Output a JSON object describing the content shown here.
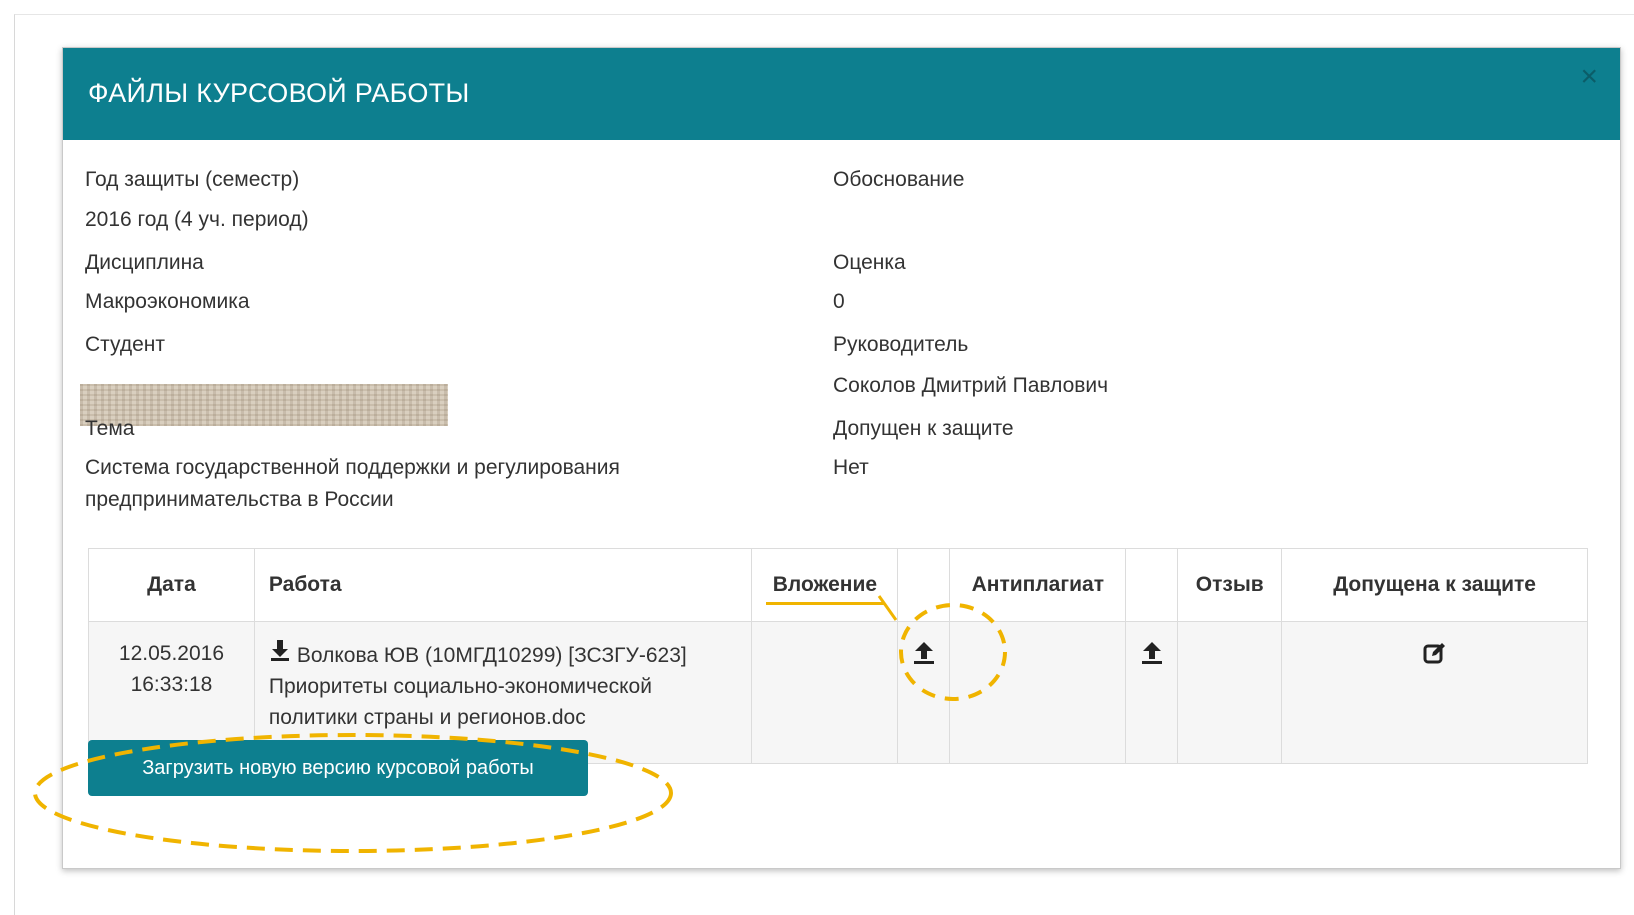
{
  "modal": {
    "title": "ФАЙЛЫ КУРСОВОЙ РАБОТЫ",
    "close_symbol": "×"
  },
  "fields": {
    "year_label": "Год защиты (семестр)",
    "year_value": "2016 год (4 уч. период)",
    "discipline_label": "Дисциплина",
    "discipline_value": "Макроэкономика",
    "student_label": "Студент",
    "topic_label": "Тема",
    "topic_value_line1": "Система государственной поддержки и регулирования",
    "topic_value_line2": "предпринимательства в России",
    "justification_label": "Обоснование",
    "grade_label": "Оценка",
    "grade_value": "0",
    "supervisor_label": "Руководитель",
    "supervisor_value": "Соколов Дмитрий Павлович",
    "admitted_label": "Допущен к защите",
    "admitted_value": "Нет"
  },
  "table": {
    "headers": {
      "date": "Дата",
      "work": "Работа",
      "attachment": "Вложение",
      "antiplagiat": "Антиплагиат",
      "review": "Отзыв",
      "admitted": "Допущена к защите"
    },
    "rows": [
      {
        "date": "12.05.2016",
        "time": "16:33:18",
        "work_line1": "Волкова ЮВ (10МГД10299) [ЗСЗГУ-623]",
        "work_line2": "Приоритеты социально-экономической",
        "work_line3": "политики страны и регионов.doc"
      }
    ]
  },
  "icons": {
    "download": "download-icon",
    "upload": "upload-icon",
    "edit": "edit-icon"
  },
  "upload_button_label": "Загрузить новую версию курсовой работы",
  "colors": {
    "header_teal": "#0d7f8f",
    "annotation_yellow": "#f0b400"
  }
}
